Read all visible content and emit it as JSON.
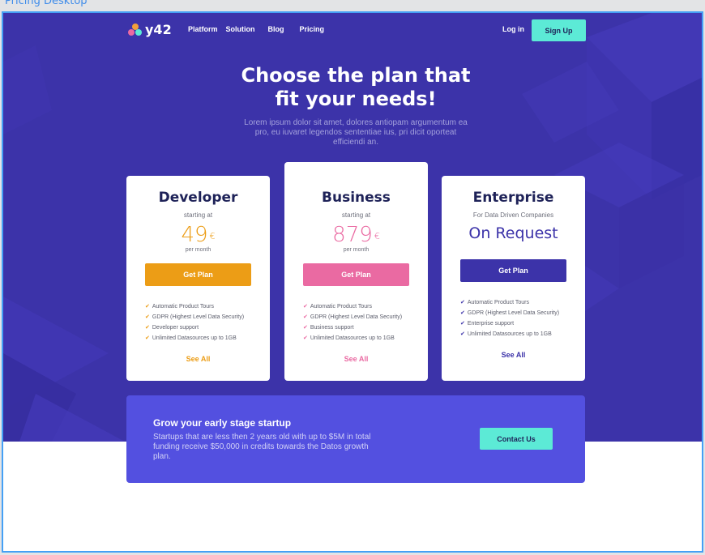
{
  "frame": {
    "label": "Pricing Desktop"
  },
  "nav": {
    "brand": "y42",
    "links": [
      "Platform",
      "Solution",
      "Blog",
      "Pricing"
    ],
    "login": "Log in",
    "signup": "Sign Up"
  },
  "hero": {
    "headline_line1": "Choose the plan that",
    "headline_line2": "fit your needs!",
    "subtext": "Lorem ipsum dolor sit amet, dolores antiopam argumentum ea pro, eu iuvaret legendos sententiae ius, pri dicit oporteat efficiendi an."
  },
  "plans": [
    {
      "name": "Developer",
      "subtitle": "starting at",
      "price": "49",
      "currency": "€",
      "period": "per month",
      "button": "Get Plan",
      "features": [
        "Automatic Product Tours",
        "GDPR (Highest Level Data Security)",
        "Developer support",
        "Unlimited Datasources up to 1GB"
      ],
      "see_all": "See All",
      "accent": "#ec9d16"
    },
    {
      "name": "Business",
      "subtitle": "starting at",
      "price": "879",
      "currency": "€",
      "period": "per month",
      "button": "Get Plan",
      "features": [
        "Automatic Product Tours",
        "GDPR (Highest Level Data Security)",
        "Business support",
        "Unlimited Datasources up to 1GB"
      ],
      "see_all": "See All",
      "accent": "#ea6aa2"
    },
    {
      "name": "Enterprise",
      "subtitle": "For Data Driven Companies",
      "price_text": "On Request",
      "button": "Get Plan",
      "features": [
        "Automatic Product Tours",
        "GDPR (Highest Level Data Security)",
        "Enterprise support",
        "Unlimited Datasources up to 1GB"
      ],
      "see_all": "See All",
      "accent": "#3c33a9"
    }
  ],
  "startup": {
    "title": "Grow your early stage startup",
    "text": "Startups that are less then 2 years old with up to $5M in total funding receive $50,000 in credits towards the Datos growth plan.",
    "button": "Contact Us"
  },
  "colors": {
    "hero_bg": "#3c33a9",
    "banner_bg": "#5350e0",
    "cta": "#5cead6",
    "heading": "#1e2258"
  },
  "icons": {
    "check": "✔"
  }
}
